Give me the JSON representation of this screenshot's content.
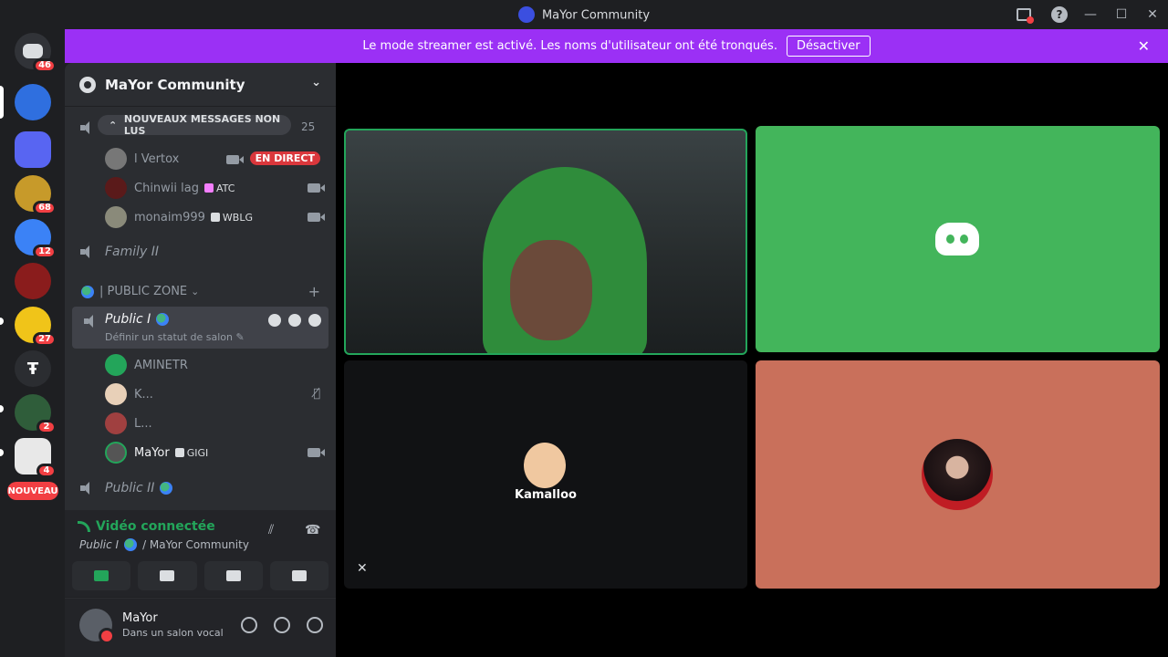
{
  "window": {
    "title": "MaYor Community",
    "controls": [
      "minimize",
      "maximize",
      "close"
    ]
  },
  "banner": {
    "text": "Le mode streamer est activé. Les noms d'utilisateur ont été tronqués.",
    "button": "Désactiver"
  },
  "guilds": {
    "home_badge": "46",
    "items": [
      {
        "badge": "",
        "color": "#2f6fdf"
      },
      {
        "badge": "",
        "color": "#5865f2"
      },
      {
        "badge": "68",
        "color": "#c79a2a"
      },
      {
        "badge": "12",
        "color": "#3b82f6"
      },
      {
        "badge": "",
        "color": "#8a1c1c"
      },
      {
        "badge": "27",
        "color": "#f0c419"
      },
      {
        "badge": "",
        "color": "#2b2d31"
      },
      {
        "badge": "2",
        "color": "#2f5d3a"
      },
      {
        "badge": "4",
        "color": "#e8e8e8"
      }
    ],
    "new_label": "NOUVEAU",
    "new_count": "1"
  },
  "sidebar": {
    "server_name": "MaYor Community",
    "unread_label": "NOUVEAUX MESSAGES NON LUS",
    "unread_count": "25",
    "members_top": [
      {
        "name": "l Vertox",
        "tag": "",
        "live": "EN DIRECT"
      },
      {
        "name": "Chinwii lag",
        "tag": "ATC",
        "live": ""
      },
      {
        "name": "monaim999",
        "tag": "WBLG",
        "live": ""
      }
    ],
    "channel_family": "Family II",
    "category": "| PUBLIC ZONE",
    "active_channel": {
      "name": "Public I",
      "status": "Définir un statut de salon"
    },
    "members": [
      {
        "name": "AMINETR",
        "tag": ""
      },
      {
        "name": "K...",
        "tag": ""
      },
      {
        "name": "L...",
        "tag": ""
      },
      {
        "name": "MaYor",
        "tag": "GIGI"
      }
    ],
    "channel_next": "Public II"
  },
  "voice": {
    "status": "Vidéo connectée",
    "channel": "Public I",
    "server": "/ MaYor Community"
  },
  "user": {
    "name": "MaYor",
    "status": "Dans un salon vocal"
  },
  "stage": {
    "tile_name": "Kamalloo"
  }
}
